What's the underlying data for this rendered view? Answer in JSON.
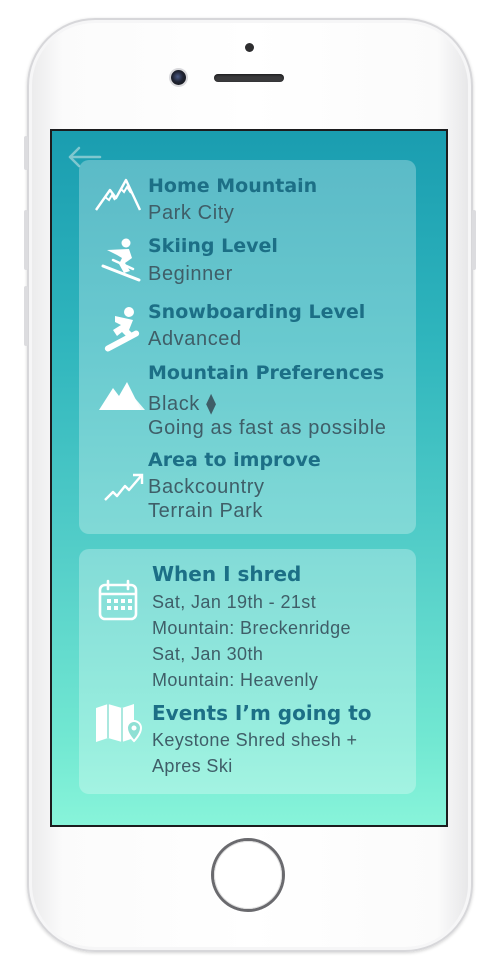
{
  "profile": {
    "home_mountain": {
      "title": "Home Mountain",
      "value": "Park City"
    },
    "skiing_level": {
      "title": "Skiing Level",
      "value": "Beginner"
    },
    "snowboarding_level": {
      "title": "Snowboarding Level",
      "value": "Advanced"
    },
    "mountain_preferences": {
      "title": "Mountain Preferences",
      "value_1": "Black ⧫",
      "value_2": "Going as fast as possible"
    },
    "area_to_improve": {
      "title": "Area to improve",
      "value_1": "Backcountry",
      "value_2": "Terrain Park"
    }
  },
  "schedule": {
    "when": {
      "title": "When I shred",
      "lines": [
        "Sat, Jan 19th - 21st",
        "Mountain: Breckenridge",
        "Sat, Jan 30th",
        "Mountain: Heavenly"
      ]
    },
    "events": {
      "title": "Events I’m going to",
      "lines": [
        "Keystone Shred shesh +",
        "Apres Ski"
      ]
    }
  },
  "icons": {
    "back": "arrow-left-icon",
    "home_mountain": "mountain-peaks-icon",
    "skiing": "skier-icon",
    "snowboarding": "snowboarder-icon",
    "preferences": "mountain-range-icon",
    "improve": "trend-up-icon",
    "calendar": "calendar-icon",
    "map": "map-pin-icon"
  },
  "colors": {
    "title": "#1c6f86",
    "value": "#3f5e68",
    "gradient_top": "#1a9db0",
    "gradient_bottom": "#88f4da"
  }
}
